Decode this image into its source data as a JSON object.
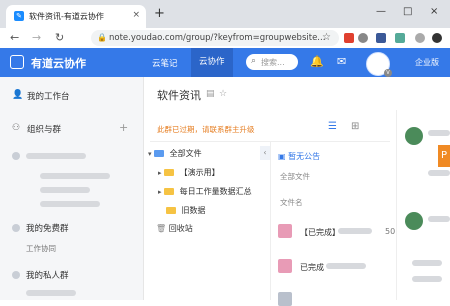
{
  "browser": {
    "tab_title": "软件资讯-有道云协作",
    "tab_close": "×",
    "new_tab": "+",
    "window_controls": [
      "—",
      "□",
      "×"
    ],
    "url": "note.youdao.com/group/?keyfrom=groupwebsite...",
    "nav": [
      "←",
      "→",
      "↻"
    ]
  },
  "header": {
    "brand": "有道云协作",
    "nav": [
      "云笔记",
      "云协作"
    ],
    "search_placeholder": "搜索...",
    "enterprise": "企业版",
    "avatar_badge": "V"
  },
  "sidebar": {
    "workspace": "我的工作台",
    "groups": "组织与群",
    "add": "+",
    "free_group": "我的免费群",
    "free_group_sub": "工作协同",
    "private_group": "我的私人群"
  },
  "main": {
    "page_title": "软件资讯",
    "notice": "此群已过期，请联系群主升级",
    "tree": {
      "all_files": "全部文件",
      "items": [
        "【演示用】",
        "每日工作量数据汇总",
        "旧数据"
      ],
      "recycle": "回收站"
    },
    "right": {
      "announcement": "暂无公告",
      "all_files": "全部文件",
      "file_name_label": "文件名",
      "files": [
        "【已完成】",
        "已完成"
      ],
      "count_fragment": "50"
    }
  },
  "feed": {
    "badge": "P"
  },
  "colors": {
    "header_blue": "#3579e8",
    "notice_orange": "#e67e22",
    "folder_yellow": "#f6c343"
  }
}
